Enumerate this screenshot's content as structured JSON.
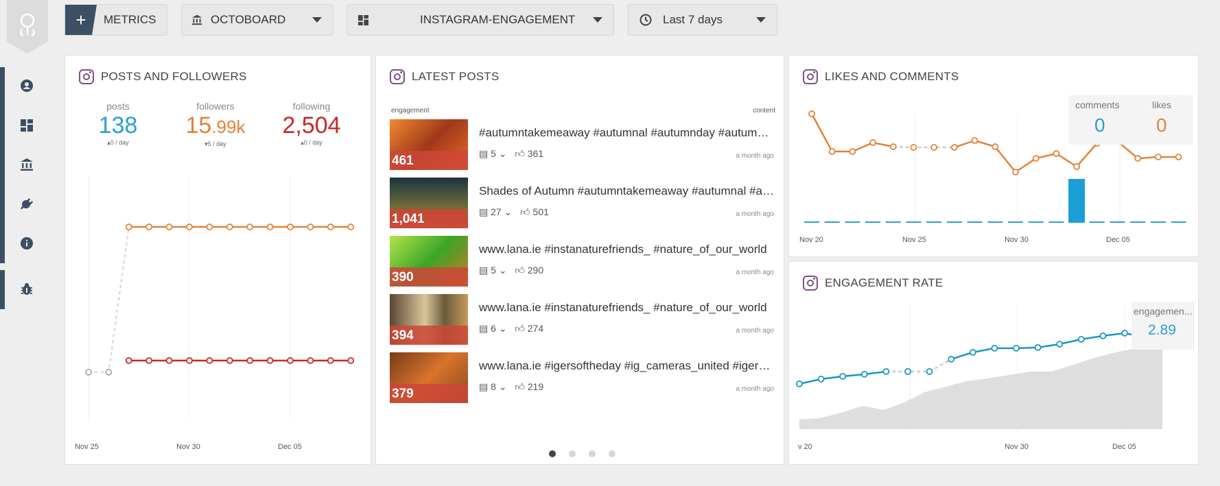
{
  "toolbar": {
    "metrics_label": "METRICS",
    "org": "OCTOBOARD",
    "board": "INSTAGRAM-ENGAGEMENT",
    "period": "Last 7 days"
  },
  "posts_followers": {
    "title": "POSTS AND FOLLOWERS",
    "stats": [
      {
        "label": "posts",
        "value": "138",
        "sub": "▴0 / day",
        "color": "#2a9fd6"
      },
      {
        "label": "followers",
        "value_main": "15",
        "value_dec": ".99k",
        "sub": "▾5 / day",
        "color": "#e2823a"
      },
      {
        "label": "following",
        "value": "2,504",
        "sub": "▴0 / day",
        "color": "#c62828"
      }
    ],
    "x_labels": [
      "Nov 25",
      "Nov 30",
      "Dec 05"
    ]
  },
  "latest_posts": {
    "title": "LATEST POSTS",
    "col_left": "engagement",
    "col_right": "content",
    "posts": [
      {
        "engagement": "461",
        "text": "#autumntakemeaway #autumnal #autumnday #autumncolors #autumnvibes",
        "comments": "5",
        "likes": "361",
        "ago": "a month ago"
      },
      {
        "engagement": "1,041",
        "text": "Shades of Autumn   #autumntakemeaway #autumnal #autumnday",
        "comments": "27",
        "likes": "501",
        "ago": "a month ago"
      },
      {
        "engagement": "390",
        "text": "www.lana.ie   #instanaturefriends_ #nature_of_our_world",
        "comments": "5",
        "likes": "290",
        "ago": "a month ago"
      },
      {
        "engagement": "394",
        "text": "www.lana.ie   #instanaturefriends_ #nature_of_our_world",
        "comments": "6",
        "likes": "274",
        "ago": "a month ago"
      },
      {
        "engagement": "379",
        "text": "www.lana.ie   #igersoftheday #ig_cameras_united #igersireland",
        "comments": "8",
        "likes": "219",
        "ago": "a month ago"
      }
    ]
  },
  "likes_comments": {
    "title": "LIKES AND COMMENTS",
    "tooltip": {
      "comments_label": "comments",
      "comments_value": "0",
      "likes_label": "likes",
      "likes_value": "0"
    },
    "x_labels": [
      "Nov 20",
      "Nov 25",
      "Nov 30",
      "Dec 05"
    ]
  },
  "engagement_rate": {
    "title": "ENGAGEMENT RATE",
    "tooltip": {
      "label": "engagemen...",
      "value": "2.89"
    },
    "x_labels": [
      "v 20",
      "Nov 30",
      "Dec 05"
    ]
  },
  "colors": {
    "accent": "#3d4f63",
    "instagram": "#7e4f86",
    "orange": "#e2823a",
    "red": "#c62828",
    "blue": "#2a9fd6"
  }
}
